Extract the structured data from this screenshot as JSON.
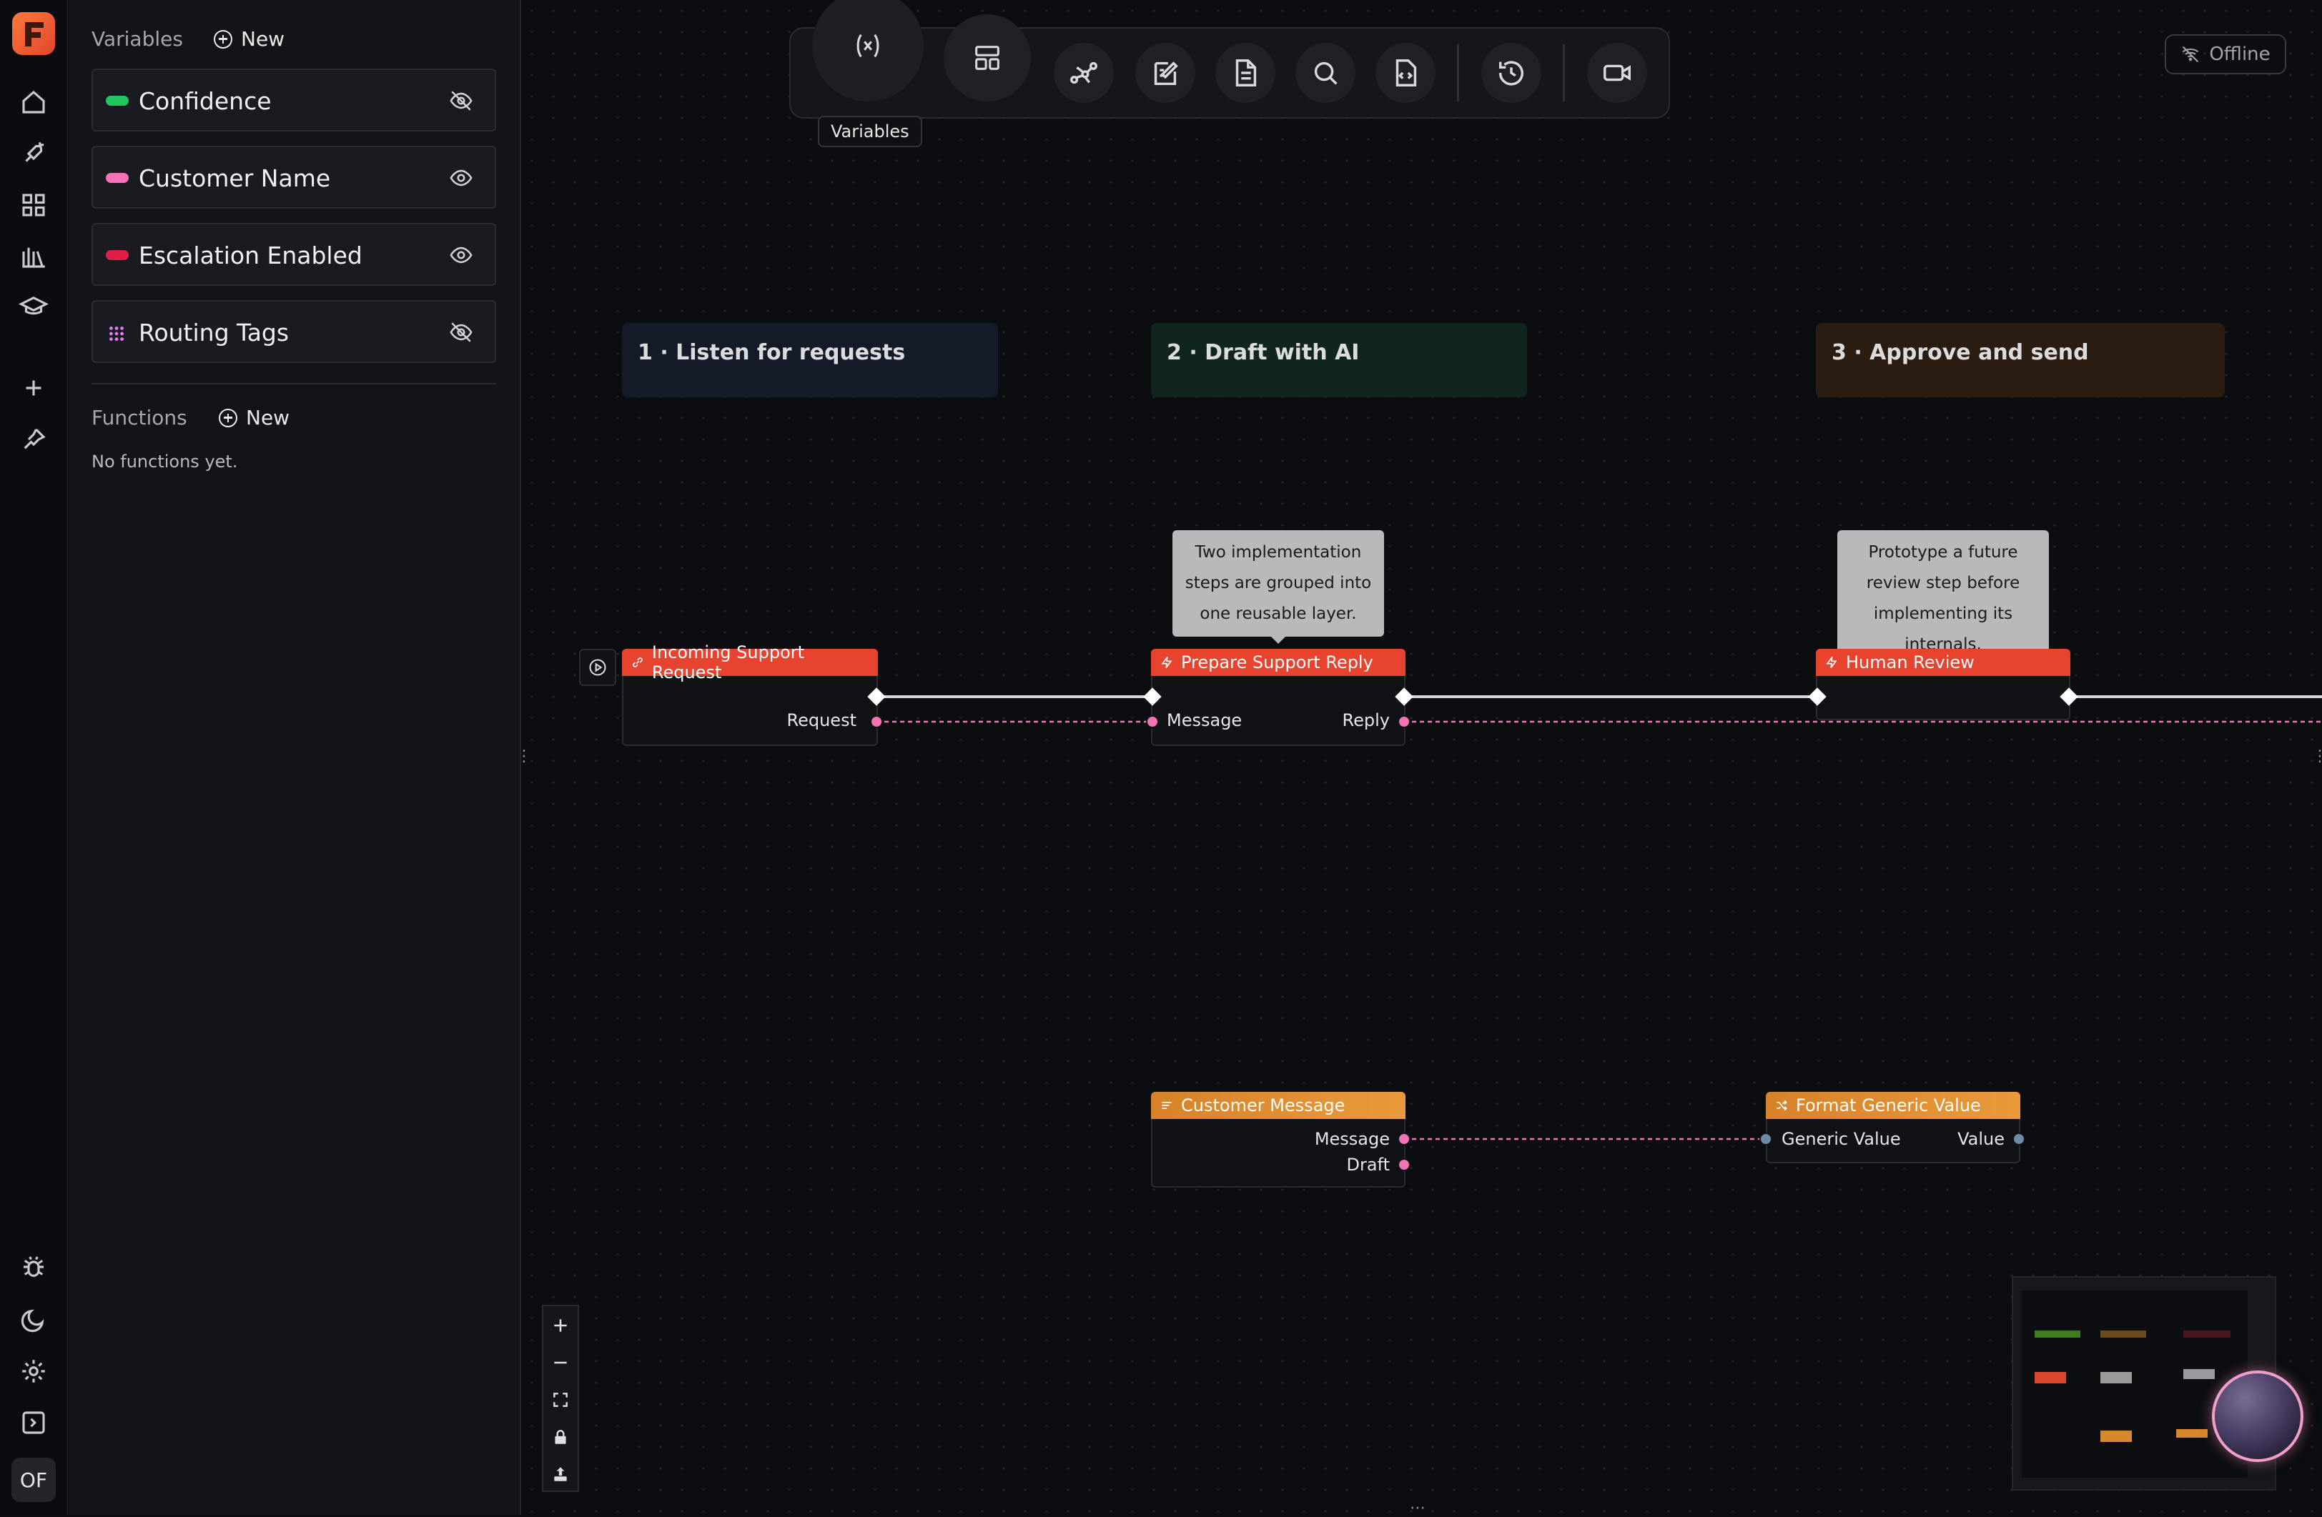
{
  "sidebar": {
    "variables_title": "Variables",
    "new_label": "New",
    "variables": [
      {
        "name": "Confidence",
        "color": "#22c55e",
        "visible": false
      },
      {
        "name": "Customer Name",
        "color": "#f472b6",
        "visible": true
      },
      {
        "name": "Escalation Enabled",
        "color": "#e11d48",
        "visible": true
      },
      {
        "name": "Routing Tags",
        "color": "#e879f9",
        "visible": false
      }
    ],
    "functions_title": "Functions",
    "functions_new_label": "New",
    "no_functions": "No functions yet."
  },
  "toolbar": {
    "tooltip": "Variables",
    "icons": [
      "variables-icon",
      "layout-icon",
      "graph-icon",
      "edit-icon",
      "document-icon",
      "search-icon",
      "code-file-icon",
      "history-icon",
      "video-icon"
    ]
  },
  "status": {
    "offline_label": "Offline"
  },
  "stages": [
    {
      "label": "1 · Listen for requests",
      "color": "#131a28"
    },
    {
      "label": "2 · Draft with AI",
      "color": "#112520"
    },
    {
      "label": "3 · Approve and send",
      "color": "#2a1c10"
    }
  ],
  "notes": [
    "Two implementation steps are grouped into one reusable layer.",
    "Prototype a future review step before implementing its internals."
  ],
  "nodes": {
    "incoming": {
      "title": "Incoming Support Request",
      "out_port": "Request",
      "color": "#e8432e"
    },
    "prepare": {
      "title": "Prepare Support Reply",
      "in_port": "Message",
      "out_port": "Reply",
      "color": "#e8432e"
    },
    "review": {
      "title": "Human Review",
      "color": "#e8432e"
    },
    "customer_message": {
      "title": "Customer Message",
      "out_ports": [
        "Message",
        "Draft"
      ],
      "color": "#e8902e"
    },
    "format_value": {
      "title": "Format Generic Value",
      "in_port": "Generic Value",
      "out_port": "Value",
      "color": "#e8902e"
    }
  },
  "user": {
    "initials": "OF"
  }
}
